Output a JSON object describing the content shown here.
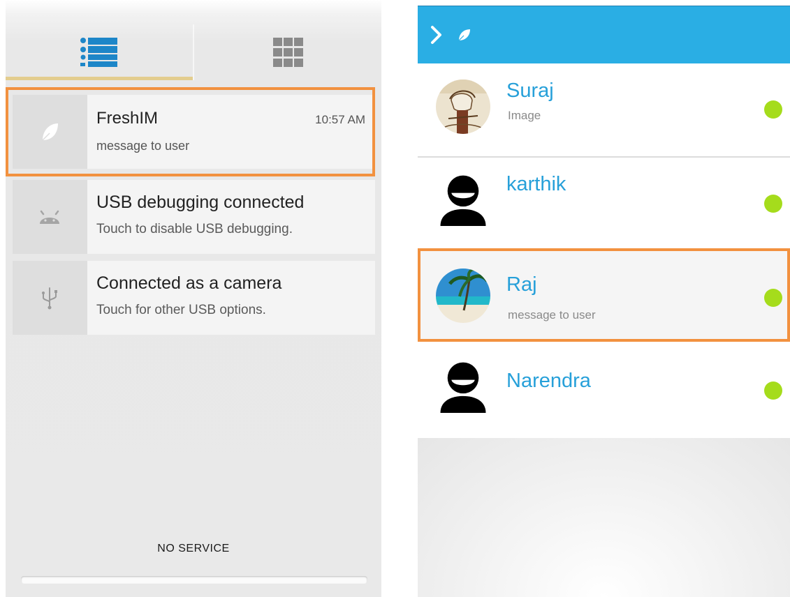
{
  "notification_shade": {
    "tabs": [
      {
        "name": "list-view-icon",
        "selected": true
      },
      {
        "name": "grid-view-icon",
        "selected": false
      }
    ],
    "notifications": [
      {
        "title": "FreshIM",
        "subtitle": "message to user",
        "time": "10:57 AM",
        "icon": "leaf-icon"
      },
      {
        "title": "USB debugging connected",
        "subtitle": "Touch to disable USB debugging.",
        "icon": "android-icon"
      },
      {
        "title": "Connected as a camera",
        "subtitle": "Touch for other USB options.",
        "icon": "usb-icon"
      }
    ],
    "status_text": "NO SERVICE"
  },
  "contacts_app": {
    "appbar": {
      "nav_icon": "chevron-right-icon",
      "logo_icon": "leaf-icon",
      "color": "#2aaee4"
    },
    "contacts": [
      {
        "name": "Suraj",
        "subtitle": "Image",
        "avatar": "sketch-photo-avatar",
        "online": true
      },
      {
        "name": "karthik",
        "subtitle": "",
        "avatar": "default-person-avatar",
        "online": true
      },
      {
        "name": "Raj",
        "subtitle": "message to user",
        "avatar": "beach-photo-avatar",
        "online": true
      },
      {
        "name": "Narendra",
        "subtitle": "",
        "avatar": "default-person-avatar",
        "online": true
      }
    ],
    "online_color": "#a5dc1c",
    "name_color": "#27a0d9"
  },
  "highlight_color": "#f2913f"
}
